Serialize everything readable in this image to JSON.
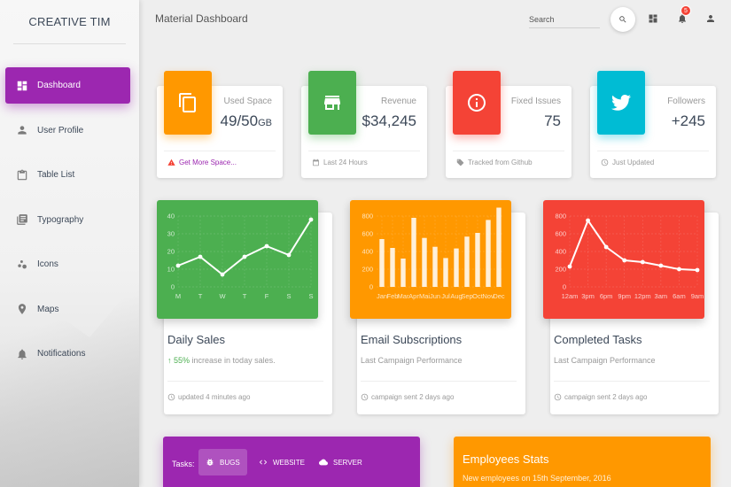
{
  "sidebar": {
    "brand": "CREATIVE TIM",
    "items": [
      {
        "label": "Dashboard",
        "icon": "dashboard-icon",
        "active": true
      },
      {
        "label": "User Profile",
        "icon": "person-icon"
      },
      {
        "label": "Table List",
        "icon": "clipboard-icon"
      },
      {
        "label": "Typography",
        "icon": "library-books-icon"
      },
      {
        "label": "Icons",
        "icon": "bubble-chart-icon"
      },
      {
        "label": "Maps",
        "icon": "location-pin-icon"
      },
      {
        "label": "Notifications",
        "icon": "bell-icon"
      }
    ]
  },
  "header": {
    "title": "Material Dashboard",
    "search_label": "Search",
    "notification_count": "5"
  },
  "stats": [
    {
      "category": "Used Space",
      "value": "49/50",
      "unit": "GB",
      "footer": "Get More Space...",
      "color": "#ff9800",
      "icon": "content-copy-icon"
    },
    {
      "category": "Revenue",
      "value": "$34,245",
      "footer": "Last 24 Hours",
      "color": "#4caf50",
      "icon": "store-icon"
    },
    {
      "category": "Fixed Issues",
      "value": "75",
      "footer": "Tracked from Github",
      "color": "#f44336",
      "icon": "info-icon"
    },
    {
      "category": "Followers",
      "value": "+245",
      "footer": "Just Updated",
      "color": "#00bcd4",
      "icon": "twitter-icon"
    }
  ],
  "charts": [
    {
      "title": "Daily Sales",
      "sub_highlight": "55%",
      "sub_rest": " increase in today sales.",
      "footer": "updated 4 minutes ago",
      "color": "#4caf50"
    },
    {
      "title": "Email Subscriptions",
      "sub": "Last Campaign Performance",
      "footer": "campaign sent 2 days ago",
      "color": "#ff9800"
    },
    {
      "title": "Completed Tasks",
      "sub": "Last Campaign Performance",
      "footer": "campaign sent 2 days ago",
      "color": "#f44336"
    }
  ],
  "chart_data": [
    {
      "type": "line",
      "categories": [
        "M",
        "T",
        "W",
        "T",
        "F",
        "S",
        "S"
      ],
      "values": [
        12,
        17,
        7,
        17,
        23,
        18,
        38
      ],
      "ylim": [
        0,
        40
      ],
      "yticks": [
        0,
        10,
        20,
        30,
        40
      ],
      "grid": true
    },
    {
      "type": "bar",
      "categories": [
        "Jan",
        "Feb",
        "Mar",
        "Apr",
        "Mai",
        "Jun",
        "Jul",
        "Aug",
        "Sep",
        "Oct",
        "Nov",
        "Dec"
      ],
      "values": [
        540,
        440,
        320,
        780,
        553,
        453,
        326,
        434,
        568,
        610,
        756,
        895
      ],
      "ylim": [
        0,
        800
      ],
      "yticks": [
        0,
        200,
        400,
        600,
        800
      ],
      "grid": true
    },
    {
      "type": "line",
      "categories": [
        "12am",
        "3pm",
        "6pm",
        "9pm",
        "12pm",
        "3am",
        "6am",
        "9am"
      ],
      "values": [
        230,
        750,
        450,
        300,
        280,
        240,
        200,
        190
      ],
      "ylim": [
        0,
        800
      ],
      "yticks": [
        0,
        200,
        400,
        600,
        800
      ],
      "grid": true
    }
  ],
  "tasks": {
    "label": "Tasks:",
    "tabs": [
      {
        "label": "BUGS",
        "icon": "bug-icon",
        "active": true
      },
      {
        "label": "WEBSITE",
        "icon": "code-icon"
      },
      {
        "label": "SERVER",
        "icon": "cloud-icon"
      }
    ]
  },
  "employees": {
    "title": "Employees Stats",
    "subtitle": "New employees on 15th September, 2016"
  }
}
